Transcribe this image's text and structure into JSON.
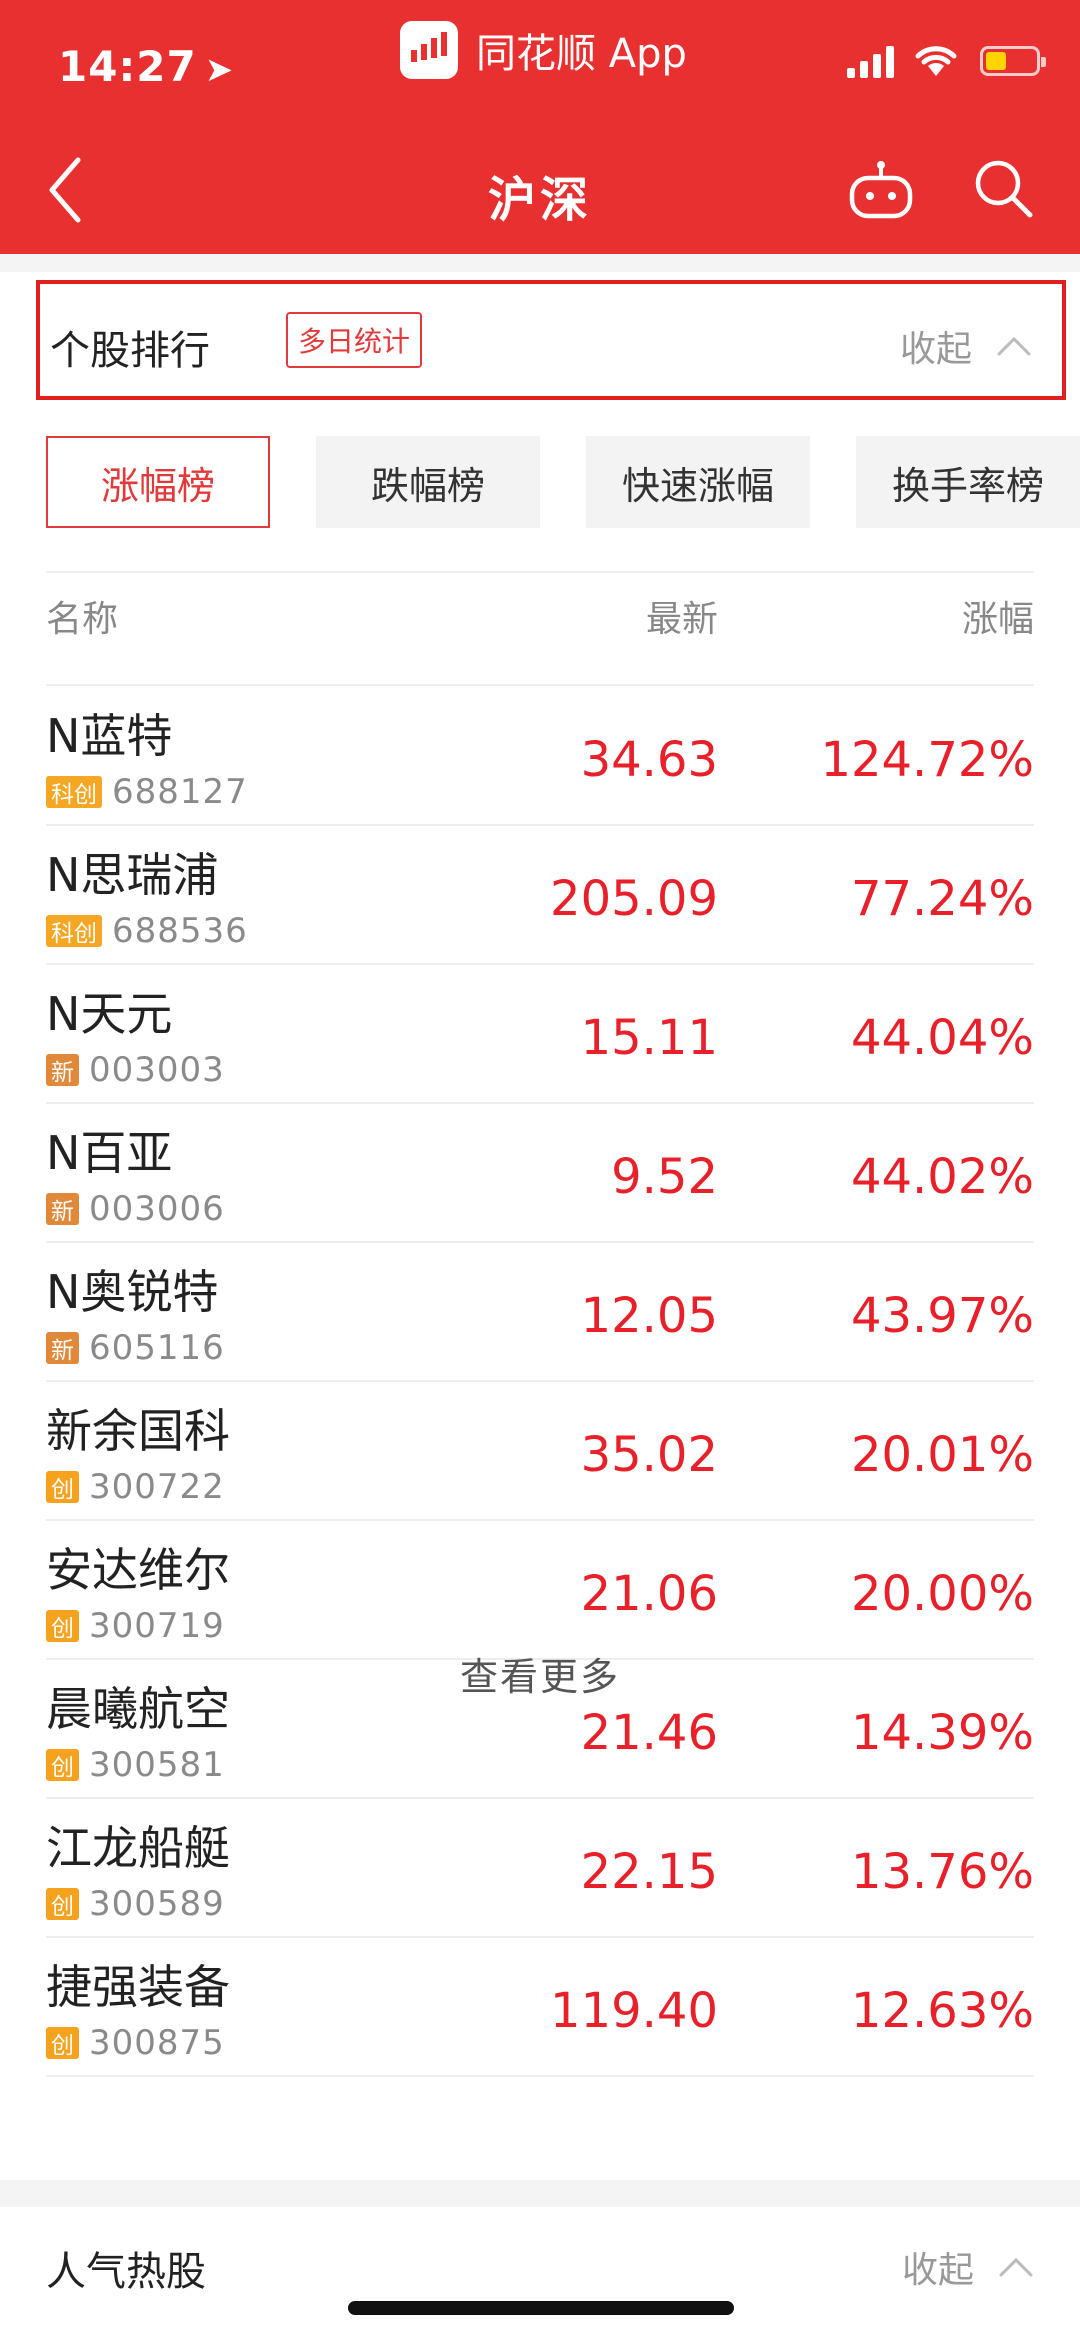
{
  "status": {
    "time": "14:27",
    "app_name": "同花顺 App"
  },
  "nav": {
    "title": "沪深"
  },
  "section": {
    "title": "个股排行",
    "badge": "多日统计",
    "collapse_label": "收起",
    "tabs": [
      "涨幅榜",
      "跌幅榜",
      "快速涨幅",
      "换手率榜"
    ],
    "columns": {
      "name": "名称",
      "latest": "最新",
      "change": "涨幅"
    },
    "rows": [
      {
        "name": "N蓝特",
        "tag": "科创",
        "code": "688127",
        "price": "34.63",
        "pct": "124.72%"
      },
      {
        "name": "N思瑞浦",
        "tag": "科创",
        "code": "688536",
        "price": "205.09",
        "pct": "77.24%"
      },
      {
        "name": "N天元",
        "tag": "新",
        "code": "003003",
        "price": "15.11",
        "pct": "44.04%"
      },
      {
        "name": "N百亚",
        "tag": "新",
        "code": "003006",
        "price": "9.52",
        "pct": "44.02%"
      },
      {
        "name": "N奥锐特",
        "tag": "新",
        "code": "605116",
        "price": "12.05",
        "pct": "43.97%"
      },
      {
        "name": "新余国科",
        "tag": "创",
        "code": "300722",
        "price": "35.02",
        "pct": "20.01%"
      },
      {
        "name": "安达维尔",
        "tag": "创",
        "code": "300719",
        "price": "21.06",
        "pct": "20.00%"
      },
      {
        "name": "晨曦航空",
        "tag": "创",
        "code": "300581",
        "price": "21.46",
        "pct": "14.39%"
      },
      {
        "name": "江龙船艇",
        "tag": "创",
        "code": "300589",
        "price": "22.15",
        "pct": "13.76%"
      },
      {
        "name": "捷强装备",
        "tag": "创",
        "code": "300875",
        "price": "119.40",
        "pct": "12.63%"
      }
    ],
    "more_label": "查看更多"
  },
  "section2": {
    "title": "人气热股",
    "collapse_label": "收起"
  },
  "colors": {
    "header": "#e93030",
    "up": "#e8202a",
    "tag_kechuang": "#f5a623",
    "tag_xin": "#e0893b",
    "tag_chuang": "#f5a21f"
  }
}
